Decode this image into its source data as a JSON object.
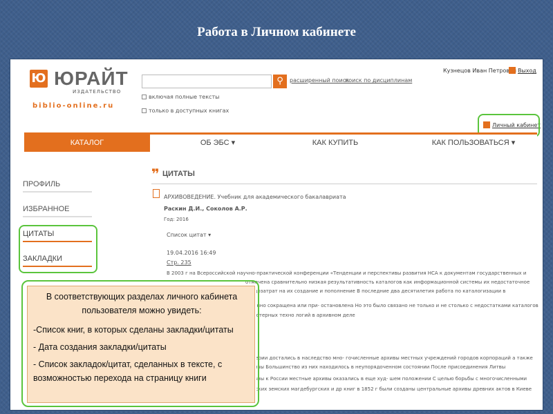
{
  "slide": {
    "title": "Работа в Личном кабинете"
  },
  "header": {
    "logo": {
      "mark": "Ю",
      "name": "ЮРАЙТ",
      "sub": "ИЗДАТЕЛЬСТВО",
      "url": "biblio-online.ru"
    },
    "search": {
      "placeholder": "",
      "button_icon": "search-icon",
      "advanced_link": "расширенный поиск",
      "disciplines_link": "поиск по дисциплинам"
    },
    "checkboxes": [
      "включая полные тексты",
      "только в доступных книгах"
    ],
    "user": {
      "name": "Кузнецов Иван Петрович",
      "exit_label": "Выход"
    },
    "cabinet_link": "Личный кабинет"
  },
  "nav": {
    "items": [
      "КАТАЛОГ",
      "ОБ ЭБС ▾",
      "КАК КУПИТЬ",
      "КАК ПОЛЬЗОВАТЬСЯ ▾"
    ],
    "active": 0
  },
  "sidebar": {
    "items": [
      "ПРОФИЛЬ",
      "ИЗБРАННОЕ",
      "ЦИТАТЫ",
      "ЗАКЛАДКИ"
    ],
    "active": 2
  },
  "main": {
    "section_title": "ЦИТАТЫ",
    "book": {
      "title": "АРХИВОВЕДЕНИЕ. Учебник для академического бакалавриата",
      "authors": "Раскин Д.И., Соколов А.Р.",
      "year": "Год: 2016"
    },
    "quotes_toggle": "Список цитат ▾",
    "entry": {
      "datetime": "19.04.2016 16:49",
      "page_link": "Стр. 235"
    },
    "text_lines": [
      "В 2003 г на Всероссийской научно-практической конференции «Тенденции и перспективы развития НСА к документам государственных и",
      "отмечена сравнительно низкая результативность каталогов как информационной системы их недостаточное",
      "трудозатрат на их создание и пополнение В последние два десятилетия работа по каталогизации в",
      "ственно сокращена или при- остановлена Но это было связано не только и не столько с недостатками каталогов",
      "мпьютерных техно логий в архивном деле"
    ],
    "text_lines_2": [
      "империи достались в наследство мно- гочисленные архивы местных учреждений городов корпораций а также",
      "архивы Большинство из них находилось в неупорядоченном состоянии После присоединения Литвы",
      "кравны к России местные архивы оказались в еще худ- шем положении С целью борьбы с многочисленными",
      "фальсификация ми актовых городских земских магдебургских и др книг в 1852 г были созданы центральные архивы древних актов в Киеве"
    ]
  },
  "callout": {
    "heading_1": "В соответствующих разделах  личного кабинета",
    "heading_2": "пользователя можно увидеть:",
    "items": [
      "-Список книг, в которых сделаны закладки/цитаты",
      "- Дата создания закладки/цитаты",
      "- Список закладок/цитат, сделанных в тексте, с",
      "возможностью перехода на страницу книги"
    ]
  },
  "colors": {
    "accent": "#e36f1e",
    "highlight": "#5ac43c",
    "callout_bg": "#fbe3c8",
    "slide_bg": "#3f5f8c"
  }
}
